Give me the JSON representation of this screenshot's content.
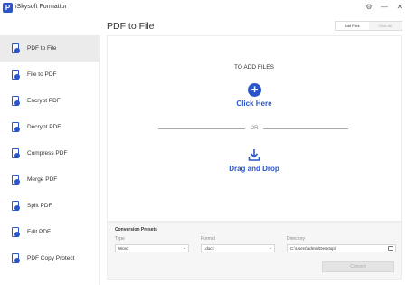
{
  "app": {
    "title": "iSkysoft Formattor",
    "logo_letter": "P"
  },
  "window_controls": {
    "settings": "⚙",
    "minimize": "—",
    "close": "✕"
  },
  "sidebar": {
    "items": [
      {
        "label": "PDF to File",
        "active": true
      },
      {
        "label": "File to PDF",
        "active": false
      },
      {
        "label": "Encrypt PDF",
        "active": false
      },
      {
        "label": "Decrypt PDF",
        "active": false
      },
      {
        "label": "Compress PDF",
        "active": false
      },
      {
        "label": "Merge PDF",
        "active": false
      },
      {
        "label": "Split PDF",
        "active": false
      },
      {
        "label": "Edit PDF",
        "active": false
      },
      {
        "label": "PDF Copy Protect",
        "active": false
      }
    ]
  },
  "header": {
    "title": "PDF to File",
    "tabs": [
      {
        "label": "Add Files",
        "active": true
      },
      {
        "label": "Clear All",
        "active": false
      }
    ]
  },
  "dropzone": {
    "heading": "TO ADD FILES",
    "click_here": "Click Here",
    "or": "OR",
    "drag_drop": "Drag and Drop"
  },
  "presets": {
    "title": "Conversion Presets",
    "type_label": "Type",
    "type_value": "Word",
    "format_label": "Format",
    "format_value": ".docx",
    "directory_label": "Directory",
    "directory_value": "C:\\Users\\admin\\Desktop\\",
    "convert_label": "Convert"
  },
  "colors": {
    "accent": "#2b55c8",
    "active_bg": "#ebebeb"
  }
}
